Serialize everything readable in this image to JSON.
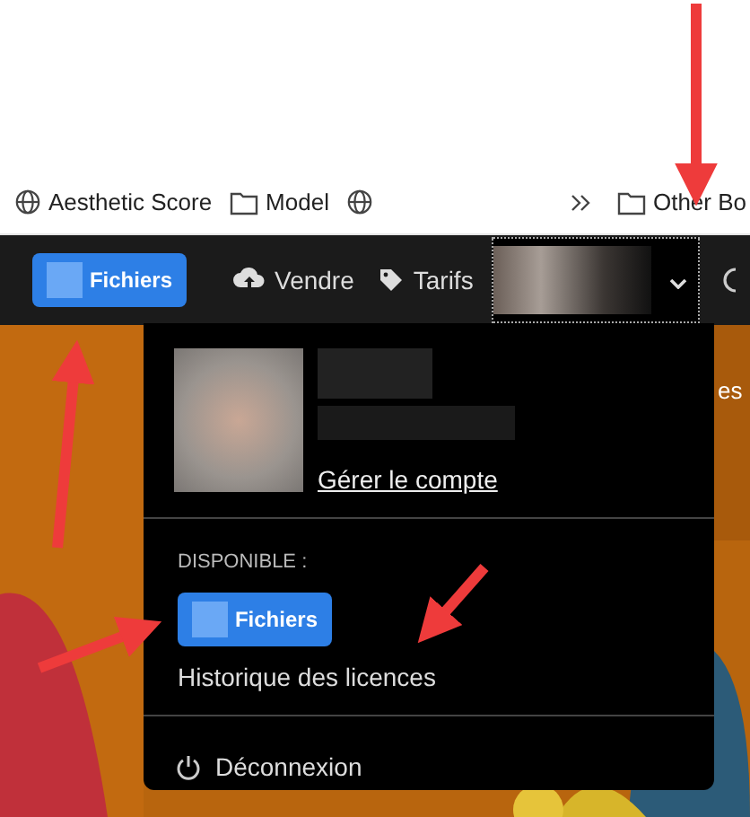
{
  "bookmarks": [
    {
      "kind": "globe",
      "label": "Aesthetic Score"
    },
    {
      "kind": "folder",
      "label": "Model"
    },
    {
      "kind": "globe"
    }
  ],
  "other_bookmarks": {
    "label": "Other Bo"
  },
  "navbar": {
    "files_button": "Fichiers",
    "links": [
      {
        "kind": "upload",
        "label": "Vendre"
      },
      {
        "kind": "tag",
        "label": "Tarifs"
      }
    ],
    "profile": {
      "expanded": true
    }
  },
  "background": {
    "text": "es"
  },
  "account_menu": {
    "manage_link": "Gérer le compte",
    "section_label": "DISPONIBLE :",
    "files_button": "Fichiers",
    "license_link": "Historique des licences",
    "logout": "Déconnexion"
  }
}
